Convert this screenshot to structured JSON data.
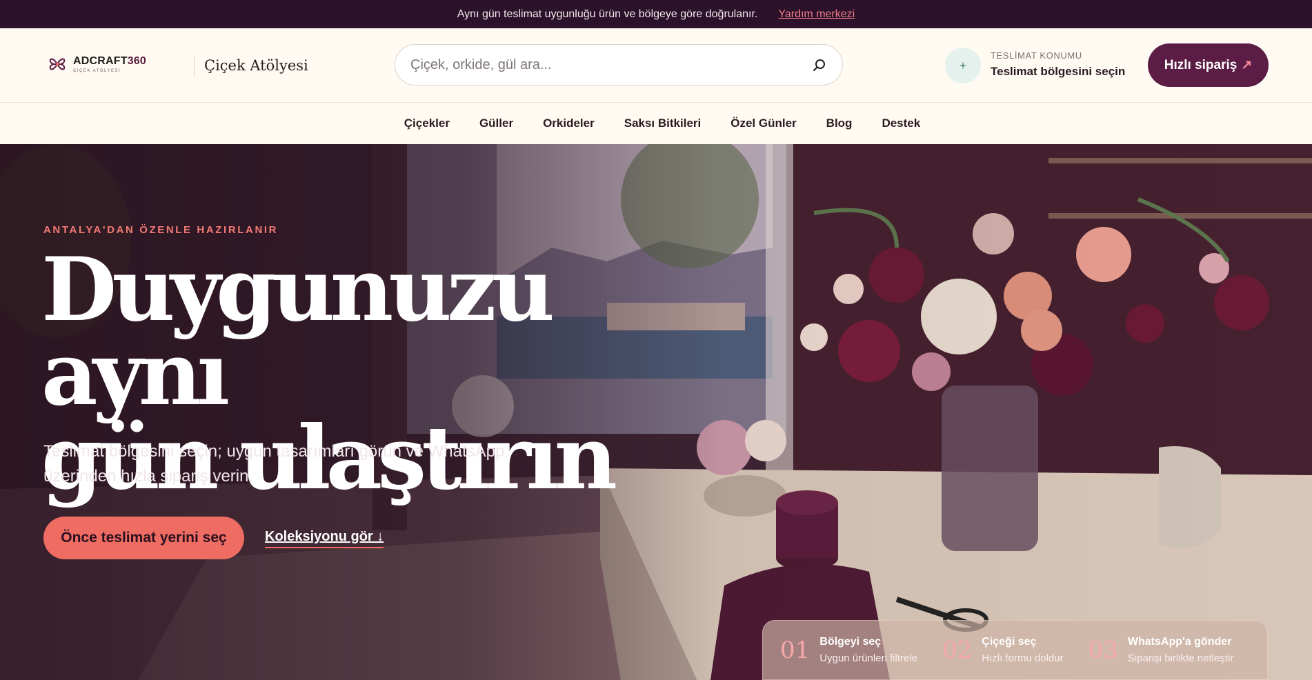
{
  "topbar": {
    "message": "Aynı gün teslimat uygunluğu ürün ve bölgeye göre doğrulanır.",
    "help_link": "Yardım merkezi"
  },
  "header": {
    "logo_name": "ADCRAFT",
    "logo_number": "360",
    "logo_sub": "ÇİÇEK ATÖLYESİ",
    "brand": "Çiçek Atölyesi",
    "search_placeholder": "Çiçek, orkide, gül ara...",
    "location_label": "TESLİMAT KONUMU",
    "location_value": "Teslimat bölgesini seçin",
    "quick_order": "Hızlı sipariş",
    "quick_order_arrow": "↗"
  },
  "nav": {
    "items": [
      "Çiçekler",
      "Güller",
      "Orkideler",
      "Saksı Bitkileri",
      "Özel Günler",
      "Blog",
      "Destek"
    ]
  },
  "hero": {
    "eyebrow": "ANTALYA'DAN ÖZENLE HAZIRLANIR",
    "headline_line1": "Duygunuzu aynı",
    "headline_line2": "gün ulaştırın",
    "subhead": "Teslimat bölgesini seçin; uygun tasarımları görün ve WhatsApp üzerinden hızla sipariş verin.",
    "cta_primary": "Önce teslimat yerini seç",
    "cta_secondary": "Koleksiyonu gör ↓"
  },
  "steps": [
    {
      "num": "01",
      "title": "Bölgeyi seç",
      "desc": "Uygun ürünleri filtrele"
    },
    {
      "num": "02",
      "title": "Çiçeği seç",
      "desc": "Hızlı formu doldur"
    },
    {
      "num": "03",
      "title": "WhatsApp'a gönder",
      "desc": "Siparişi birlikte netleştir"
    }
  ],
  "colors": {
    "topbar_bg": "#2b1129",
    "accent_coral": "#ee6c62",
    "plum": "#5b1d45",
    "cream": "#fffaf2"
  }
}
